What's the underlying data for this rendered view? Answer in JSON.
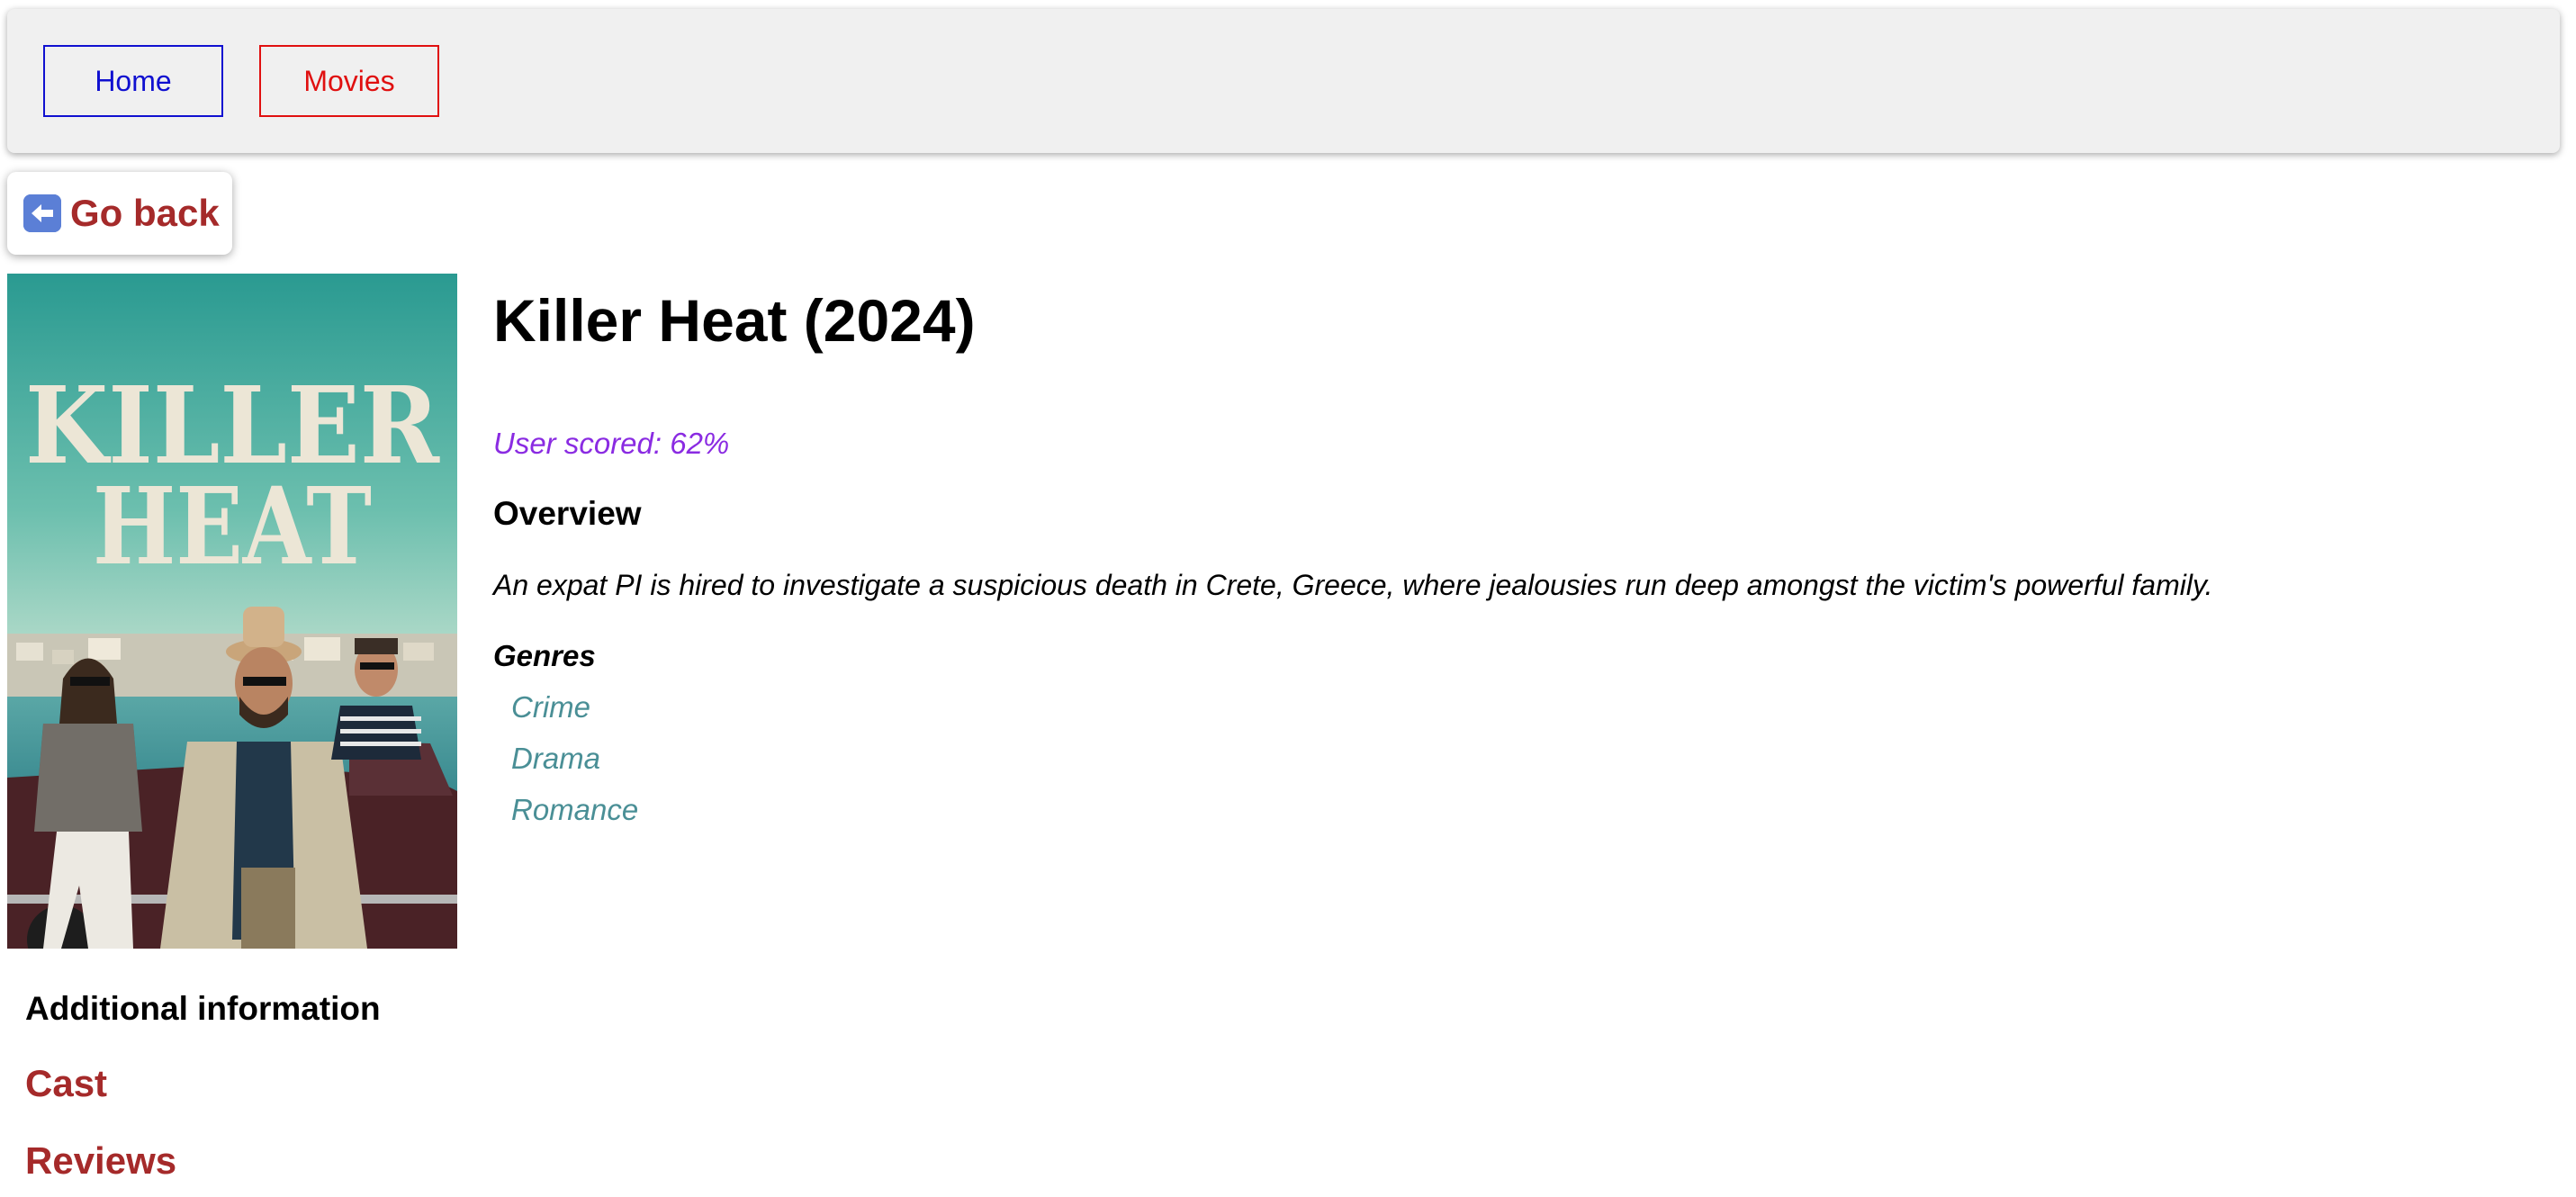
{
  "nav": {
    "home_label": "Home",
    "movies_label": "Movies",
    "home_color": "#1010d0",
    "movies_color": "#e01010"
  },
  "back": {
    "label": "Go back",
    "icon": "left-arrow-icon"
  },
  "movie": {
    "title": "Killer Heat (2024)",
    "poster": {
      "title_line1": "KILLER",
      "title_line2": "HEAT"
    },
    "score": "User scored: 62%",
    "overview_heading": "Overview",
    "overview": "An expat PI is hired to investigate a suspicious death in Crete, Greece, where jealousies run deep amongst the victim's powerful family.",
    "genres_heading": "Genres",
    "genres": [
      "Crime",
      "Drama",
      "Romance"
    ]
  },
  "additional": {
    "heading": "Additional information",
    "cast_label": "Cast",
    "reviews_label": "Reviews"
  },
  "colors": {
    "link_brown": "#a52a2a",
    "score_purple": "#8a2be2",
    "genre_teal": "#4a8f96"
  }
}
